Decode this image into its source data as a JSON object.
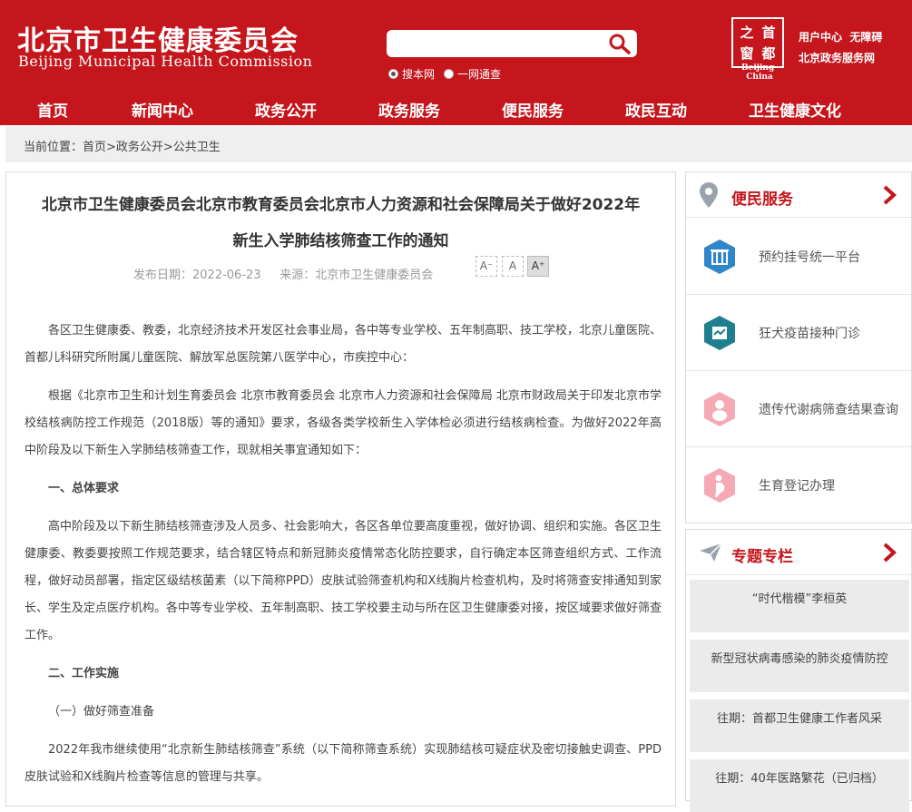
{
  "header": {
    "title_cn": "北京市卫生健康委员会",
    "title_en": "Beijing Municipal Health Commission",
    "search": {
      "placeholder": "",
      "value": ""
    },
    "search_options": [
      "搜本网",
      "一网通查"
    ],
    "seal_chars": [
      "之",
      "首",
      "窗",
      "都"
    ],
    "seal_caption": "Beijing-China",
    "links_row1": [
      "用户中心",
      "无障碍"
    ],
    "links_row2": "北京政务服务网",
    "brand_color": "#c4161c"
  },
  "nav": [
    "首页",
    "新闻中心",
    "政务公开",
    "政务服务",
    "便民服务",
    "政民互动",
    "卫生健康文化"
  ],
  "breadcrumb": "当前位置：首页>政务公开>公共卫生",
  "article": {
    "title_line1": "北京市卫生健康委员会北京市教育委员会北京市人力资源和社会保障局关于做好2022年",
    "title_line2": "新生入学肺结核筛查工作的通知",
    "date": "发布日期：2022-06-23",
    "source": "来源：北京市卫生健康委员会",
    "font_sizes": [
      "A⁻",
      "A",
      "A⁺"
    ],
    "paragraphs": [
      {
        "type": "p",
        "text": "各区卫生健康委、教委，北京经济技术开发区社会事业局，各中等专业学校、五年制高职、技工学校，北京儿童医院、首都儿科研究所附属儿童医院、解放军总医院第八医学中心，市疾控中心："
      },
      {
        "type": "p",
        "text": "根据《北京市卫生和计划生育委员会 北京市教育委员会 北京市人力资源和社会保障局 北京市财政局关于印发北京市学校结核病防控工作规范（2018版）等的通知》要求，各级各类学校新生入学体检必须进行结核病检查。为做好2022年高中阶段及以下新生入学肺结核筛查工作，现就相关事宜通知如下："
      },
      {
        "type": "h",
        "text": "一、总体要求"
      },
      {
        "type": "p",
        "text": "高中阶段及以下新生肺结核筛查涉及人员多、社会影响大，各区各单位要高度重视，做好协调、组织和实施。各区卫生健康委、教委要按照工作规范要求，结合辖区特点和新冠肺炎疫情常态化防控要求，自行确定本区筛查组织方式、工作流程，做好动员部署，指定区级结核菌素（以下简称PPD）皮肤试验筛查机构和X线胸片检查机构，及时将筛查安排通知到家长、学生及定点医疗机构。各中等专业学校、五年制高职、技工学校要主动与所在区卫生健康委对接，按区域要求做好筛查工作。"
      },
      {
        "type": "h",
        "text": "二、工作实施"
      },
      {
        "type": "p",
        "text": "（一）做好筛查准备"
      },
      {
        "type": "p",
        "text": "2022年我市继续使用“北京新生肺结核筛查”系统（以下简称筛查系统）实现肺结核可疑症状及密切接触史调查、PPD皮肤试验和X线胸片检查等信息的管理与共享。"
      }
    ]
  },
  "sidebar": {
    "services_title": "便民服务",
    "services": [
      {
        "label": "预约挂号统一平台",
        "icon": "hospital-icon",
        "color": "#2f86c9"
      },
      {
        "label": "狂犬疫苗接种门诊",
        "icon": "clinic-icon",
        "color": "#1f7f8f"
      },
      {
        "label": "遗传代谢病筛查结果查询",
        "icon": "baby-icon",
        "color": "#f4a9b5"
      },
      {
        "label": "生育登记办理",
        "icon": "pregnancy-icon",
        "color": "#f4a9b5"
      }
    ],
    "topics_title": "专题专栏",
    "topics": [
      "“时代楷模”李桓英",
      "新型冠状病毒感染的肺炎疫情防控",
      "往期：首都卫生健康工作者风采",
      "往期：40年医路繁花（已归档）"
    ]
  }
}
